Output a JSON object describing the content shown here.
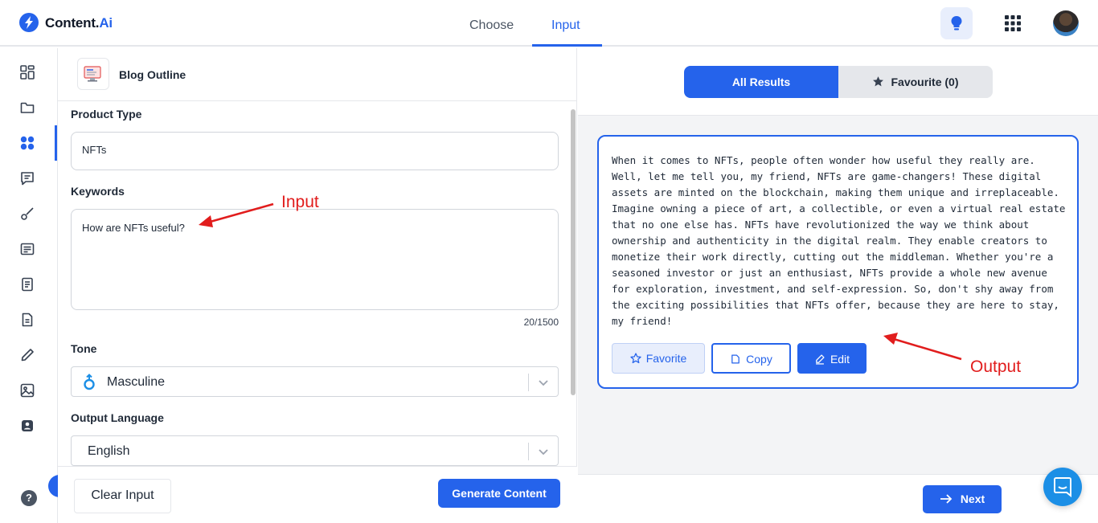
{
  "app": {
    "logo_main": "Content.",
    "logo_accent": "Ai",
    "colors": {
      "accent": "#2563eb",
      "annotation": "#e11d1d"
    }
  },
  "topbar": {
    "tabs": [
      {
        "label": "Choose",
        "active": false
      },
      {
        "label": "Input",
        "active": true
      }
    ],
    "icons": [
      "lightbulb-icon",
      "apps-grid-icon",
      "avatar"
    ]
  },
  "sidebar": {
    "items": [
      "dashboard-icon",
      "folder-icon",
      "templates-icon",
      "chat-icon",
      "paint-brush-icon",
      "article-icon",
      "document-icon",
      "file-text-icon",
      "pencil-icon",
      "image-icon",
      "assistant-icon"
    ],
    "active_index": 2,
    "help_label": "?",
    "expand_label": "›"
  },
  "tool": {
    "title": "Blog Outline"
  },
  "form": {
    "product_type_label": "Product Type",
    "product_type_value": "NFTs",
    "keywords_label": "Keywords",
    "keywords_value": "How are NFTs useful?",
    "counter": "20/1500",
    "tone_label": "Tone",
    "tone_value": "Masculine",
    "language_label": "Output Language",
    "language_value": "English",
    "clear_label": "Clear Input",
    "generate_label": "Generate Content"
  },
  "results": {
    "tab_all": "All Results",
    "tab_fav": "Favourite (0)",
    "text": "When it comes to NFTs, people often wonder how useful they really are. Well, let me tell you, my friend, NFTs are game-changers! These digital assets are minted on the blockchain, making them unique and irreplaceable. Imagine owning a piece of art, a collectible, or even a virtual real estate that no one else has. NFTs have revolutionized the way we think about ownership and authenticity in the digital realm. They enable creators to monetize their work directly, cutting out the middleman. Whether you're a seasoned investor or just an enthusiast, NFTs provide a whole new avenue for exploration, investment, and self-expression. So, don't shy away from the exciting possibilities that NFTs offer, because they are here to stay, my friend!",
    "favorite_label": "Favorite",
    "copy_label": "Copy",
    "edit_label": "Edit",
    "next_label": "Next"
  },
  "annotations": {
    "input_label": "Input",
    "output_label": "Output"
  }
}
